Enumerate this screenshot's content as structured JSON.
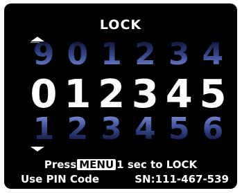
{
  "screen": {
    "title": "LOCK",
    "digit_rows": {
      "above": [
        "9",
        "0",
        "1",
        "2",
        "3",
        "4"
      ],
      "selected": [
        "0",
        "1",
        "2",
        "3",
        "4",
        "5"
      ],
      "below": [
        "1",
        "2",
        "3",
        "4",
        "5",
        "6"
      ]
    },
    "instruction": {
      "prefix": "Press",
      "key_label": "MENU",
      "suffix": "1 sec to LOCK"
    },
    "footer": {
      "pin_hint": "Use PIN Code",
      "serial": "SN:111-467-539"
    },
    "icons": {
      "up": "chevron-up-icon",
      "down": "chevron-down-icon"
    },
    "colors": {
      "background": "#000000",
      "text": "#ffffff",
      "inactive_digit": "#3a4c92"
    }
  }
}
